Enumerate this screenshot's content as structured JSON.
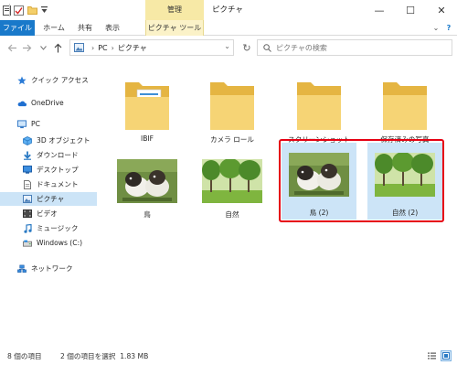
{
  "window": {
    "ribbon_context_group": "管理",
    "title": "ピクチャ",
    "minimize_glyph": "—",
    "maximize_glyph": "☐",
    "close_glyph": "✕"
  },
  "ribbon": {
    "tabs": [
      {
        "label": "ファイル"
      },
      {
        "label": "ホーム"
      },
      {
        "label": "共有"
      },
      {
        "label": "表示"
      },
      {
        "label": "ピクチャ ツール"
      }
    ],
    "expand_glyph": "⌄",
    "help_glyph": "?"
  },
  "address_bar": {
    "path": [
      "PC",
      "ピクチャ"
    ],
    "separator": "›",
    "dropdown_glyph": "⌄",
    "refresh_glyph": "↻"
  },
  "search": {
    "placeholder": "ピクチャの検索"
  },
  "nav_pane": {
    "items": [
      {
        "label": "クイック アクセス",
        "icon": "star-icon"
      },
      {
        "label": "OneDrive",
        "icon": "cloud-icon"
      },
      {
        "label": "PC",
        "icon": "pc-icon"
      },
      {
        "label": "3D オブジェクト",
        "icon": "cube-icon"
      },
      {
        "label": "ダウンロード",
        "icon": "download-icon"
      },
      {
        "label": "デスクトップ",
        "icon": "desktop-icon"
      },
      {
        "label": "ドキュメント",
        "icon": "document-icon"
      },
      {
        "label": "ピクチャ",
        "icon": "pictures-icon",
        "selected": true
      },
      {
        "label": "ビデオ",
        "icon": "video-icon"
      },
      {
        "label": "ミュージック",
        "icon": "music-icon"
      },
      {
        "label": "Windows (C:)",
        "icon": "drive-icon"
      },
      {
        "label": "ネットワーク",
        "icon": "network-icon"
      }
    ]
  },
  "files": [
    {
      "name": "IBIF",
      "kind": "folder"
    },
    {
      "name": "カメラ ロール",
      "kind": "folder"
    },
    {
      "name": "スクリーンショット",
      "kind": "folder"
    },
    {
      "name": "保存済みの写真",
      "kind": "folder"
    },
    {
      "name": "鳥",
      "kind": "image-birds"
    },
    {
      "name": "自然",
      "kind": "image-trees"
    },
    {
      "name": "鳥 (2)",
      "kind": "image-birds",
      "selected": true
    },
    {
      "name": "自然 (2)",
      "kind": "image-trees",
      "selected": true
    }
  ],
  "status_bar": {
    "item_count": "8 個の項目",
    "selection": "2 個の項目を選択  1.83 MB"
  },
  "colors": {
    "accent": "#1979ca",
    "selection": "#cce4f7",
    "context_tab": "#f7e9a6",
    "highlight_frame": "#e60012",
    "folder": "#f4cf6a"
  }
}
